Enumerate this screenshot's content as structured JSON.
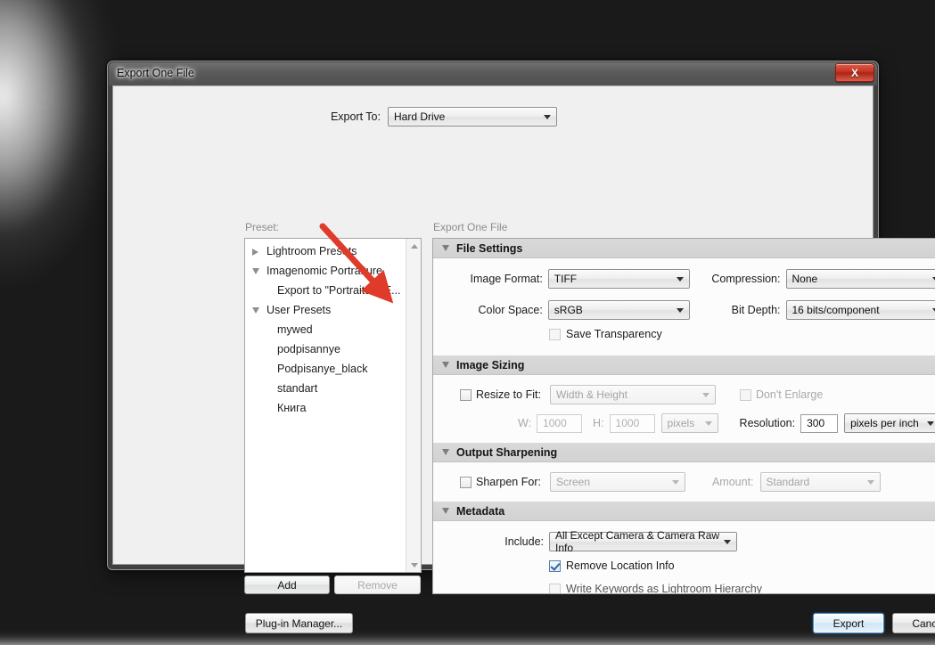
{
  "window": {
    "title": "Export One File",
    "close_label": "X"
  },
  "top": {
    "export_to_label": "Export To:",
    "export_to_value": "Hard Drive",
    "preset_label": "Preset:",
    "panel_header_label": "Export One File"
  },
  "presets": {
    "items": [
      {
        "label": "Lightroom Presets",
        "indent": 0,
        "twisty": "closed"
      },
      {
        "label": "Imagenomic Portraiture",
        "indent": 0,
        "twisty": "open"
      },
      {
        "label": "Export to \"Portraiture E...",
        "indent": 1,
        "twisty": "none"
      },
      {
        "label": "User Presets",
        "indent": 0,
        "twisty": "open"
      },
      {
        "label": "mywed",
        "indent": 1,
        "twisty": "none"
      },
      {
        "label": "podpisannye",
        "indent": 1,
        "twisty": "none"
      },
      {
        "label": "Podpisanye_black",
        "indent": 1,
        "twisty": "none"
      },
      {
        "label": "standart",
        "indent": 1,
        "twisty": "none"
      },
      {
        "label": "Книга",
        "indent": 1,
        "twisty": "none"
      }
    ],
    "add_label": "Add",
    "remove_label": "Remove"
  },
  "sections": {
    "file_settings": {
      "title": "File Settings",
      "image_format_label": "Image Format:",
      "image_format_value": "TIFF",
      "compression_label": "Compression:",
      "compression_value": "None",
      "color_space_label": "Color Space:",
      "color_space_value": "sRGB",
      "bit_depth_label": "Bit Depth:",
      "bit_depth_value": "16 bits/component",
      "save_transparency_label": "Save Transparency"
    },
    "image_sizing": {
      "title": "Image Sizing",
      "resize_to_fit_label": "Resize to Fit:",
      "resize_mode_value": "Width & Height",
      "dont_enlarge_label": "Don't Enlarge",
      "w_label": "W:",
      "w_value": "1000",
      "h_label": "H:",
      "h_value": "1000",
      "units_value": "pixels",
      "resolution_label": "Resolution:",
      "resolution_value": "300",
      "resolution_units_value": "pixels per inch"
    },
    "output_sharpening": {
      "title": "Output Sharpening",
      "sharpen_for_label": "Sharpen For:",
      "sharpen_for_value": "Screen",
      "amount_label": "Amount:",
      "amount_value": "Standard"
    },
    "metadata": {
      "title": "Metadata",
      "include_label": "Include:",
      "include_value": "All Except Camera & Camera Raw Info",
      "remove_location_label": "Remove Location Info",
      "write_keywords_label": "Write Keywords as Lightroom Hierarchy"
    }
  },
  "footer": {
    "plugin_manager_label": "Plug-in Manager...",
    "export_label": "Export",
    "cancel_label": "Cancel"
  },
  "annotation": {
    "arrow_color": "#e03a2a"
  }
}
